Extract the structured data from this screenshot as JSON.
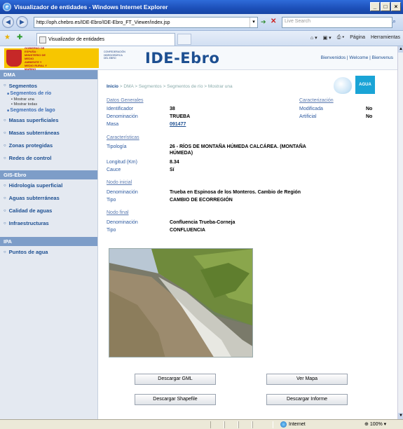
{
  "window": {
    "title": "Visualizador de entidades - Windows Internet Explorer"
  },
  "browser": {
    "url": "http://oph.chebro.es/IDE-Ebro/IDE-Ebro_FT_Viewer/index.jsp",
    "search_placeholder": "Live Search",
    "tab_label": "Visualizador de entidades",
    "tools": [
      "Página",
      "Herramientas"
    ],
    "status_zone": "Internet",
    "zoom": "100%"
  },
  "header": {
    "gov_logo_text": "GOBIERNO DE ESPAÑA · MINISTERIO DE MEDIO AMBIENTE Y MEDIO RURAL Y MARINO",
    "conf_logo_text": "CONFEDERACIÓN HIDROGRÁFICA DEL EBRO",
    "site_title": "IDE-Ebro",
    "welcome": "Bienvenidos | Welcome | Bienvenus",
    "agua_logo": "AGUA"
  },
  "sidebar": {
    "dma": {
      "title": "DMA",
      "segmentos": "Segmentos",
      "segmentos_rio": "Segmentos de río",
      "mostrar_una": "Mostrar una",
      "mostrar_todas": "Mostrar todas",
      "segmentos_lago": "Segmentos de lago",
      "masas_superficiales": "Masas superficiales",
      "masas_subterraneas": "Masas subterráneas",
      "zonas_protegidas": "Zonas protegidas",
      "redes_control": "Redes de control"
    },
    "gis": {
      "title": "GIS-Ebro",
      "hidrologia": "Hidrología superficial",
      "aguas_subterraneas": "Aguas subterráneas",
      "calidad": "Calidad de aguas",
      "infraestructuras": "Infraestructuras"
    },
    "ipa": {
      "title": "IPA",
      "puntos": "Puntos de agua"
    }
  },
  "breadcrumb": {
    "home": "Inicio",
    "rest": " > DMA > Segmentos > Segmentos de río > Mostrar una"
  },
  "datos_generales": {
    "title": "Datos Generales",
    "identificador_label": "Identificador",
    "identificador": "38",
    "denominacion_label": "Denominación",
    "denominacion": "TRUEBA",
    "masa_label": "Masa",
    "masa": "091477"
  },
  "caracterizacion": {
    "title": "Caracterización",
    "modificada_label": "Modificada",
    "modificada": "No",
    "artificial_label": "Artificial",
    "artificial": "No"
  },
  "caracteristicas": {
    "title": "Características",
    "tipologia_label": "Tipología",
    "tipologia_line1": "26 - RÍOS DE MONTAÑA HÚMEDA CALCÁREA. (MONTAÑA",
    "tipologia_line2": "HÚMEDA)",
    "longitud_label": "Longitud (Km)",
    "longitud": "8.34",
    "cauce_label": "Cauce",
    "cauce": "Sí"
  },
  "nodo_inicial": {
    "title": "Nodo inicial",
    "denominacion_label": "Denominación",
    "denominacion": "Trueba en Espinosa de los Monteros. Cambio de Región",
    "tipo_label": "Tipo",
    "tipo": "CAMBIO DE ECORREGIÓN"
  },
  "nodo_final": {
    "title": "Nodo final",
    "denominacion_label": "Denominación",
    "denominacion": "Confluencia Trueba-Corneja",
    "tipo_label": "Tipo",
    "tipo": "CONFLUENCIA"
  },
  "buttons": {
    "gml": "Descargar GML",
    "mapa": "Ver Mapa",
    "shapefile": "Descargar Shapefile",
    "informe": "Descargar Informe"
  }
}
